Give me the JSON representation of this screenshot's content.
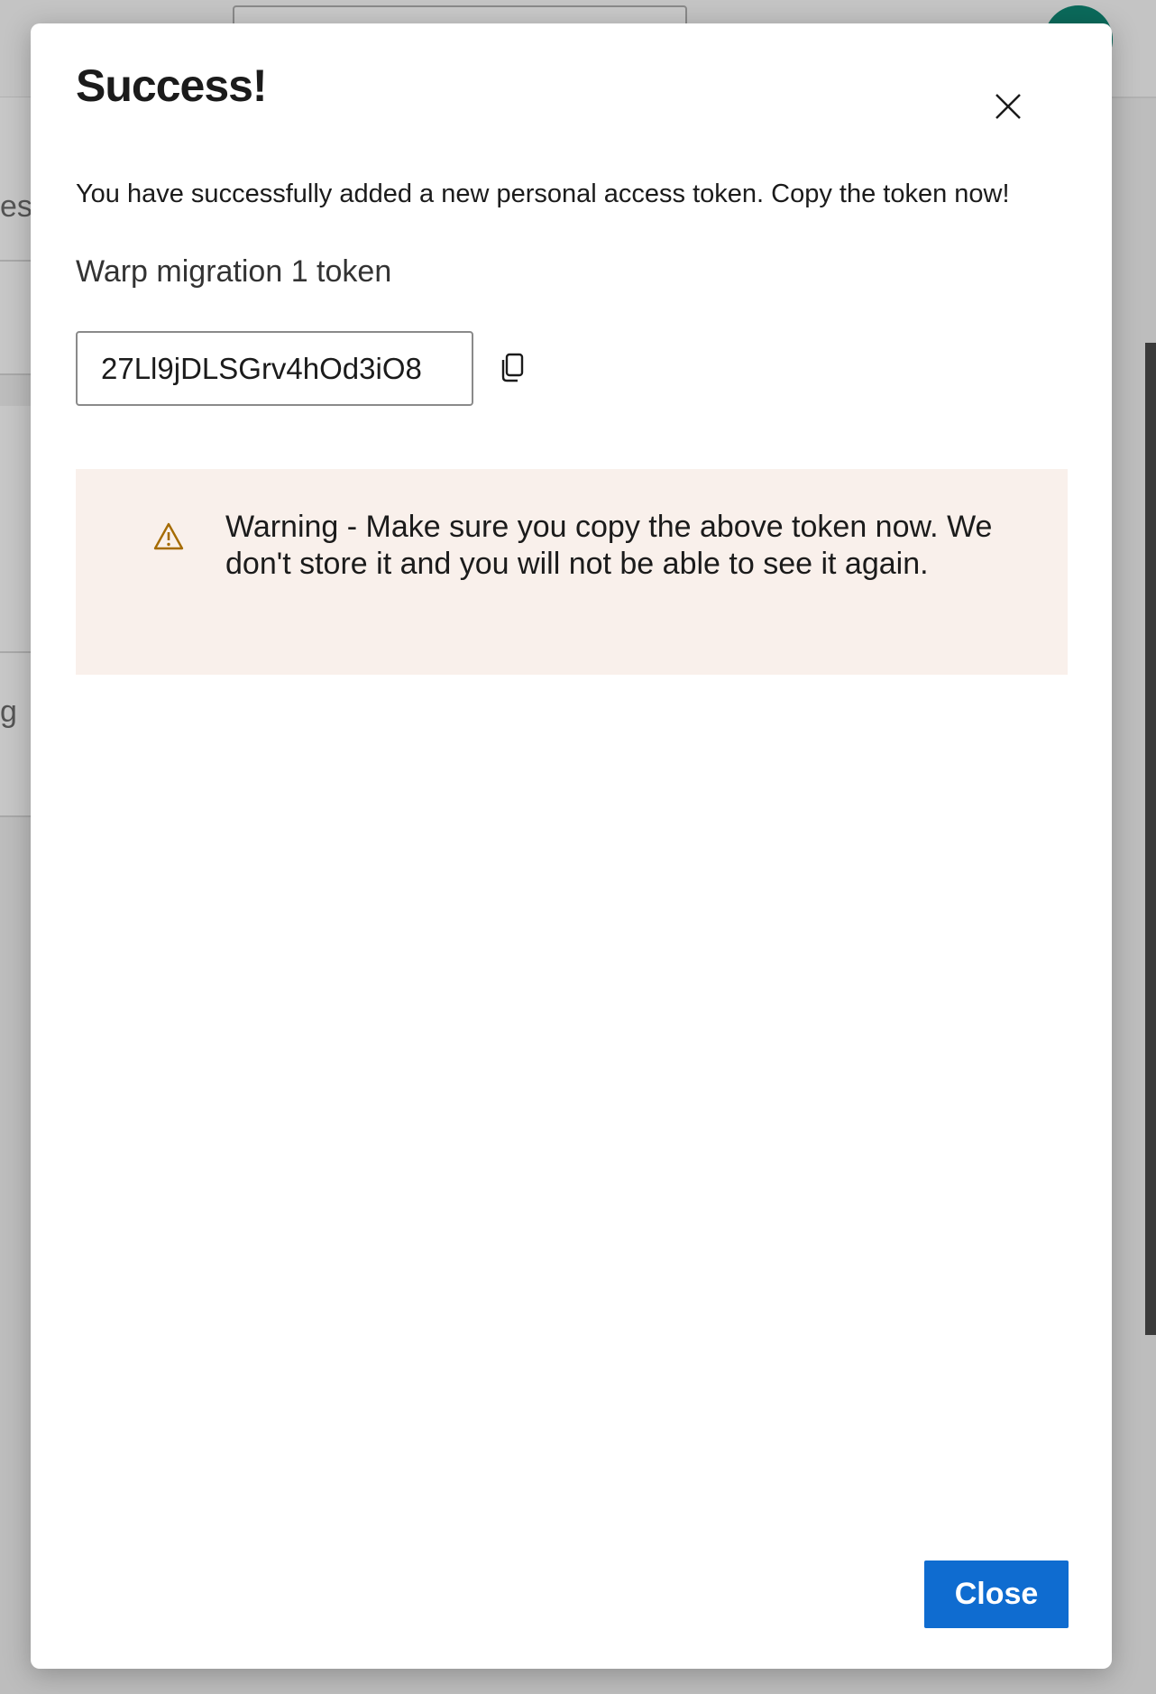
{
  "background": {
    "fragments": [
      "es",
      "g"
    ]
  },
  "dialog": {
    "title": "Success!",
    "message": "You have successfully added a new personal access token. Copy the token now!",
    "token_name": "Warp migration 1 token",
    "token_value": "27Ll9jDLSGrv4hOd3iO8",
    "copy_icon": "copy-icon",
    "close_icon": "close-icon",
    "warning": {
      "icon": "warning-triangle-icon",
      "text": "Warning - Make sure you copy the above token now. We don't store it and you will not be able to see it again."
    },
    "close_button_label": "Close"
  },
  "colors": {
    "primary_button": "#0f6cd0",
    "warning_background": "#f9f0eb",
    "warning_icon": "#a56b00",
    "avatar": "#0b6a5b"
  }
}
